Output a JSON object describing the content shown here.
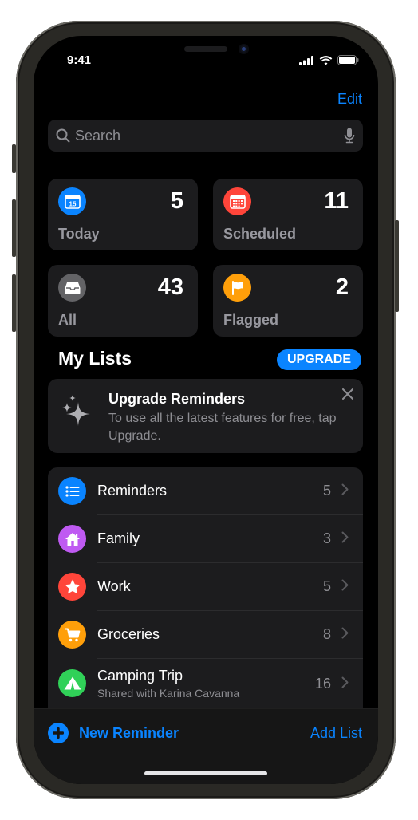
{
  "status_bar": {
    "time": "9:41",
    "icons": [
      "cellular-signal-icon",
      "wifi-icon",
      "battery-icon"
    ]
  },
  "nav": {
    "edit_label": "Edit"
  },
  "search": {
    "placeholder": "Search",
    "value": "",
    "icons": [
      "search-icon",
      "microphone-icon"
    ]
  },
  "smart_lists": [
    {
      "label": "Today",
      "count": "5",
      "icon": "calendar-today-icon",
      "color": "#0a84ff"
    },
    {
      "label": "Scheduled",
      "count": "11",
      "icon": "calendar-grid-icon",
      "color": "#ff453a"
    },
    {
      "label": "All",
      "count": "43",
      "icon": "tray-icon",
      "color": "#636366"
    },
    {
      "label": "Flagged",
      "count": "2",
      "icon": "flag-icon",
      "color": "#ff9f0a"
    }
  ],
  "today_icon_day": "15",
  "my_lists": {
    "title": "My Lists",
    "upgrade_label": "UPGRADE"
  },
  "banner": {
    "title": "Upgrade Reminders",
    "text": "To use all the latest features for free, tap Upgrade.",
    "icons": [
      "sparkles-icon",
      "close-icon"
    ]
  },
  "lists": [
    {
      "name": "Reminders",
      "count": "5",
      "icon": "list-bullet-icon",
      "color": "#0a84ff"
    },
    {
      "name": "Family",
      "count": "3",
      "icon": "house-icon",
      "color": "#bf5af2"
    },
    {
      "name": "Work",
      "count": "5",
      "icon": "star-icon",
      "color": "#ff453a"
    },
    {
      "name": "Groceries",
      "count": "8",
      "icon": "cart-icon",
      "color": "#ff9f0a"
    },
    {
      "name": "Camping Trip",
      "subtitle": "Shared with Karina Cavanna",
      "count": "16",
      "icon": "tent-icon",
      "color": "#30d158"
    }
  ],
  "toolbar": {
    "new_reminder_label": "New Reminder",
    "add_list_label": "Add List"
  },
  "colors": {
    "accent": "#0a84ff",
    "background": "#000000",
    "card": "#1c1c1e",
    "secondary_text": "#8e8e93"
  }
}
